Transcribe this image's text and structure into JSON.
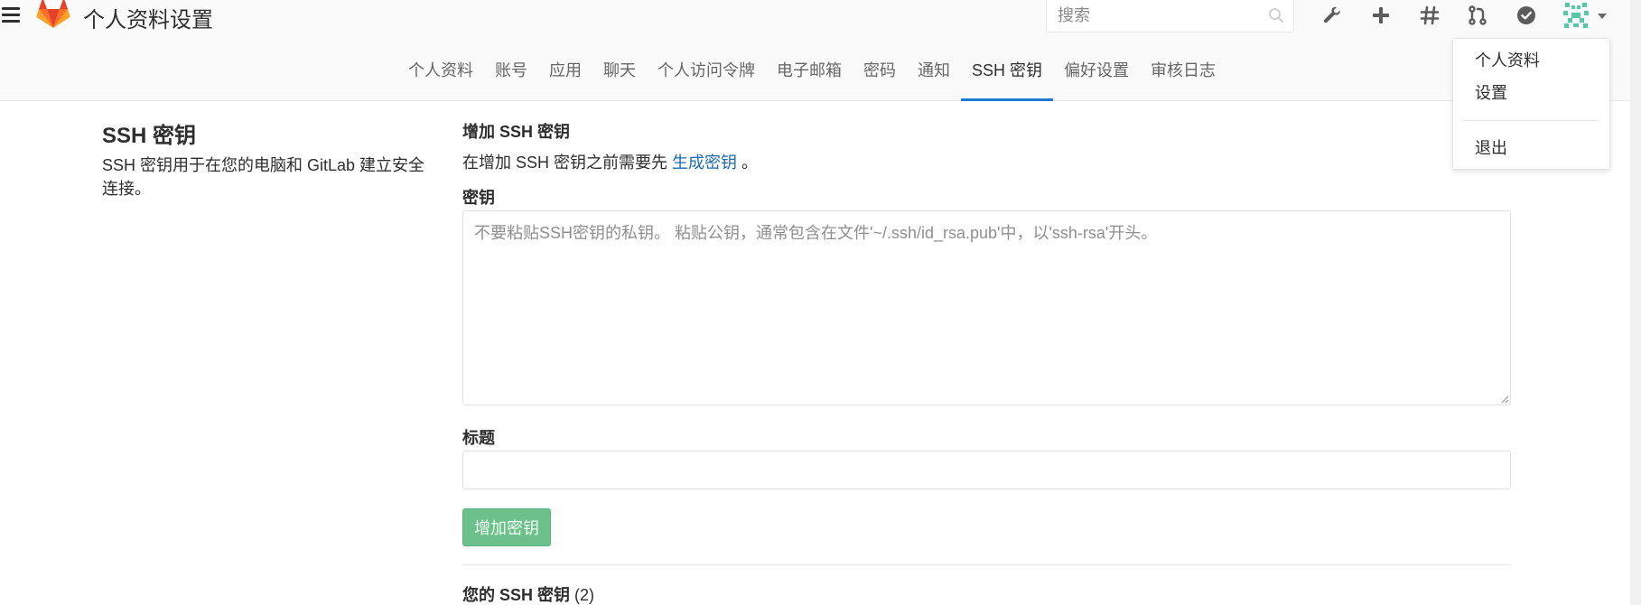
{
  "header": {
    "title": "个人资料设置",
    "search_placeholder": "搜索",
    "icons": [
      "menu-icon",
      "gitlab-logo",
      "search-icon",
      "admin-wrench-icon",
      "new-plus-icon",
      "issues-hash-icon",
      "merge-request-icon",
      "todo-check-icon",
      "avatar",
      "chevron-down-icon"
    ],
    "brand_color": "#e24329"
  },
  "subnav": {
    "tabs": [
      {
        "label": "个人资料"
      },
      {
        "label": "账号"
      },
      {
        "label": "应用"
      },
      {
        "label": "聊天"
      },
      {
        "label": "个人访问令牌"
      },
      {
        "label": "电子邮箱"
      },
      {
        "label": "密码"
      },
      {
        "label": "通知"
      },
      {
        "label": "SSH 密钥",
        "active": true
      },
      {
        "label": "偏好设置"
      },
      {
        "label": "审核日志"
      }
    ],
    "active_color": "#1f78d1"
  },
  "dropdown": {
    "profile": "个人资料",
    "settings": "设置",
    "signout": "退出"
  },
  "left": {
    "title": "SSH 密钥",
    "description": "SSH 密钥用于在您的电脑和 GitLab 建立安全连接。"
  },
  "form": {
    "heading": "增加 SSH 密钥",
    "help_prefix": "在增加 SSH 密钥之前需要先",
    "help_link": "生成密钥",
    "help_suffix": "。",
    "key_label": "密钥",
    "key_placeholder": "不要粘贴SSH密钥的私钥。 粘贴公钥，通常包含在文件'~/.ssh/id_rsa.pub'中，以'ssh-rsa'开头。",
    "key_value": "",
    "title_label": "标题",
    "title_value": "",
    "submit_label": "增加密钥",
    "submit_color": "#6cc18a"
  },
  "keys": {
    "heading": "您的 SSH 密钥",
    "count": "(2)"
  }
}
